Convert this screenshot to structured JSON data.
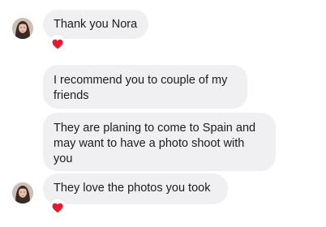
{
  "messages": [
    {
      "sender": "contact",
      "text": "Thank you Nora",
      "reaction": "heart-icon",
      "show_avatar": true
    },
    {
      "sender": "contact",
      "text": "I recommend you to couple of my friends",
      "show_avatar": false
    },
    {
      "sender": "contact",
      "text": "They are planing to come to Spain and may want to have a photo shoot with you",
      "show_avatar": false
    },
    {
      "sender": "contact",
      "text": "They love the photos you took",
      "reaction": "heart-icon",
      "show_avatar": true
    }
  ],
  "colors": {
    "bubble_bg": "#f0f0f2",
    "text": "#1c1c1e",
    "reaction_heart": "#e8192c"
  }
}
